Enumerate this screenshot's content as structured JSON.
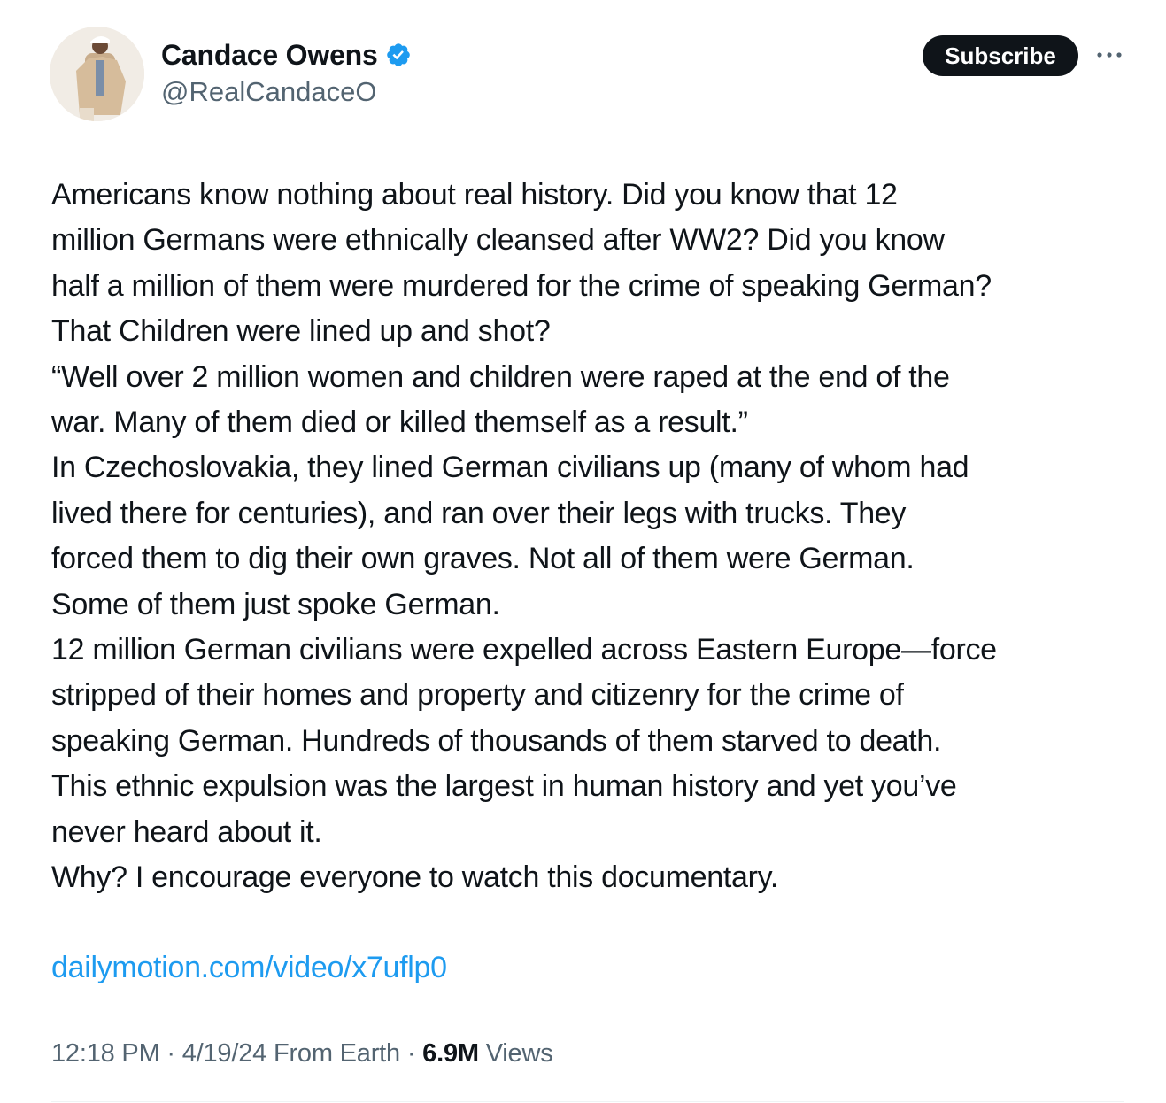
{
  "author": {
    "name": "Candace Owens",
    "handle": "@RealCandaceO",
    "verified_icon": "verified-badge-icon"
  },
  "header": {
    "subscribe_label": "Subscribe",
    "more_icon": "more-horizontal-icon"
  },
  "tweet": {
    "lines": [
      "Americans know nothing about real history. Did you know that 12",
      "million Germans were ethnically cleansed after WW2? Did you know",
      "half a million of them were murdered for the crime of speaking German?",
      "That Children were lined up and shot?",
      "“Well over 2 million women and children were raped at the end of the",
      "war. Many of them died or killed themself as a result.”",
      "In Czechoslovakia, they lined German civilians up (many of whom had",
      "lived there for centuries), and ran over their legs with trucks. They",
      "forced them to dig their own graves. Not all of them were German.",
      "Some of them just spoke German.",
      "12 million German civilians were expelled across Eastern Europe—force",
      "stripped of their homes and property and citizenry for the crime of",
      "speaking German. Hundreds of thousands of them starved to death.",
      "This ethnic expulsion was the largest in human history and yet you’ve",
      "never heard about it.",
      "Why? I encourage everyone to watch this documentary."
    ],
    "link": "dailymotion.com/video/x7uflp0"
  },
  "meta": {
    "time": "12:18 PM",
    "separator": "·",
    "date": "4/19/24",
    "source": "From Earth",
    "views_count": "6.9M",
    "views_label": "Views"
  },
  "colors": {
    "text": "#0f1419",
    "secondary": "#536471",
    "link": "#1d9bf0",
    "verified": "#1d9bf0",
    "button": "#0f1419"
  }
}
